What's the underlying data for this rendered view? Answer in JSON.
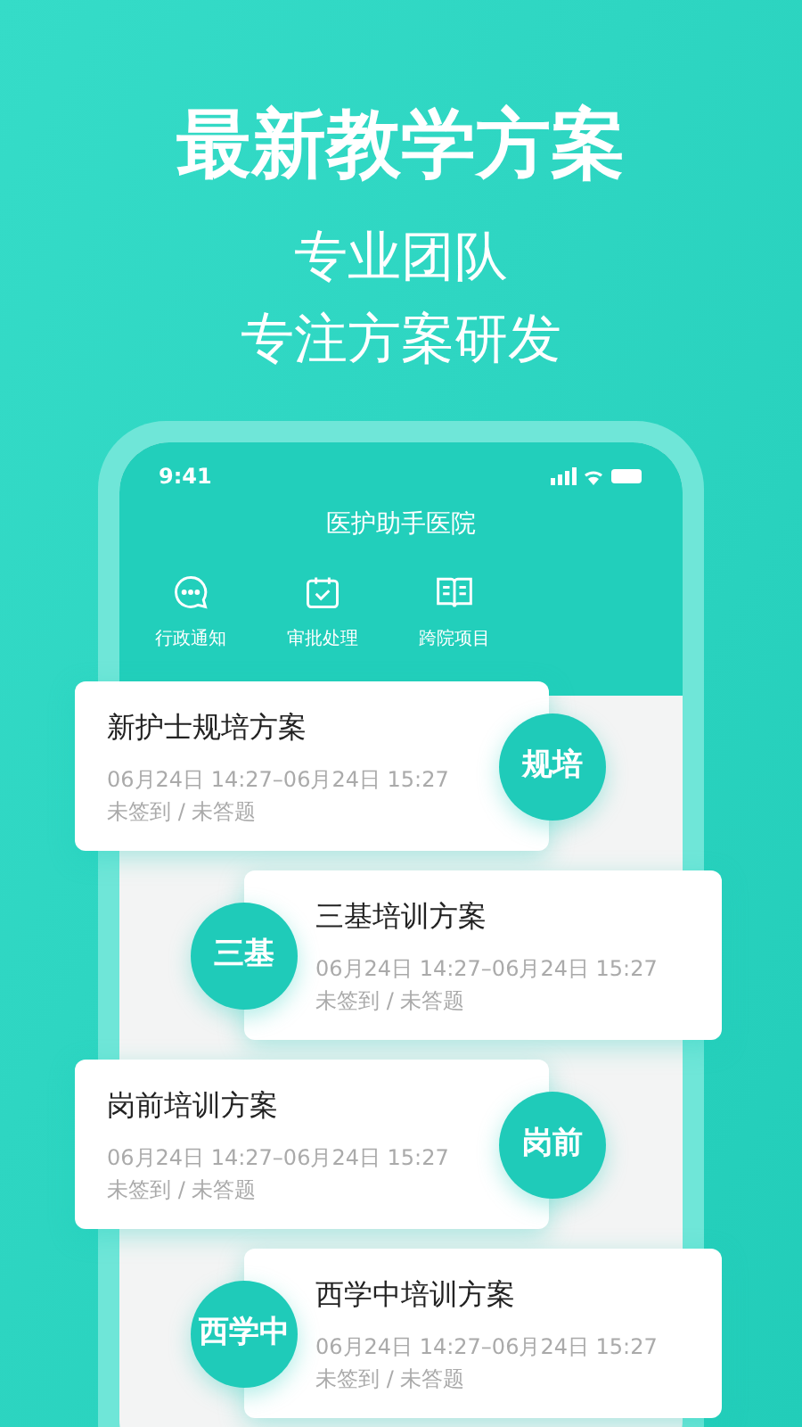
{
  "headline": "最新教学方案",
  "subtitle_lines": [
    "专业团队",
    "专注方案研发"
  ],
  "phone": {
    "status_time": "9:41",
    "header_title": "医护助手医院",
    "shortcuts": [
      {
        "kind": "chat",
        "label": "行政通知"
      },
      {
        "kind": "calendar",
        "label": "审批处理"
      },
      {
        "kind": "book",
        "label": "跨院项目"
      }
    ],
    "plans": [
      {
        "kind": "right",
        "title": "新护士规培方案",
        "time": "06月24日 14:27–06月24日 15:27",
        "status": "未签到 / 未答题",
        "badge": "规培"
      },
      {
        "kind": "left",
        "title": "三基培训方案",
        "time": "06月24日 14:27–06月24日 15:27",
        "status": "未签到 / 未答题",
        "badge": "三基"
      },
      {
        "kind": "right",
        "title": "岗前培训方案",
        "time": "06月24日 14:27–06月24日 15:27",
        "status": "未签到 / 未答题",
        "badge": "岗前"
      },
      {
        "kind": "left",
        "title": "西学中培训方案",
        "time": "06月24日 14:27–06月24日 15:27",
        "status": "未签到 / 未答题",
        "badge": "西学中"
      }
    ]
  }
}
